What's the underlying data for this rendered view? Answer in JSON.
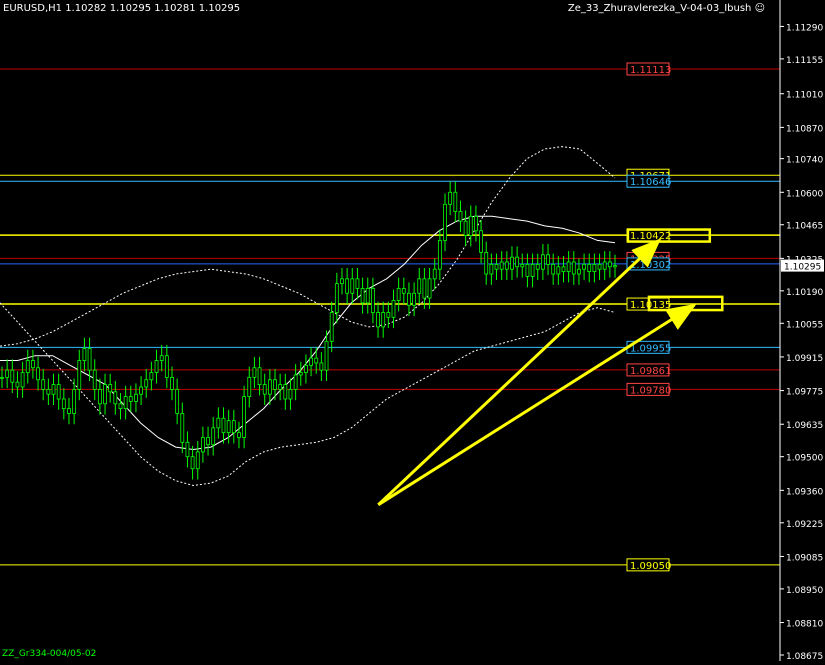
{
  "header": {
    "symbol_info": "EURUSD,H1  1.10282 1.10295 1.10281 1.10295",
    "indicator_name": "Ze_33_Zhuravlerezka_V-04-03_Ibush",
    "smiley_icon": "smiley-icon"
  },
  "footer": {
    "label": "ZZ_Gr334-004/05-02"
  },
  "colors": {
    "background": "#000000",
    "candle": "#00ff00",
    "price_line_red": "#c00000",
    "yellow": "#ffff00",
    "cyan": "#33bbff",
    "orange": "#ff8800",
    "blue": "#2266ff",
    "white": "#ffffff",
    "label_red": "#ff4444"
  },
  "chart_data": {
    "type": "candlestick",
    "symbol": "EURUSD",
    "timeframe": "H1",
    "current_price": "1.10295",
    "ylim": [
      1.0865,
      1.114
    ],
    "y_ticks": [
      "1.11290",
      "1.11155",
      "1.11010",
      "1.10870",
      "1.10740",
      "1.10600",
      "1.10465",
      "1.10325",
      "1.10190",
      "1.10055",
      "1.09915",
      "1.09775",
      "1.09635",
      "1.09500",
      "1.09360",
      "1.09225",
      "1.09085",
      "1.08950",
      "1.08810",
      "1.08675"
    ],
    "levels": [
      {
        "label": "1.11113",
        "value": 1.11113,
        "color": "#c00000",
        "label_color": "#ff4444",
        "style": "solid"
      },
      {
        "label": "1.10671",
        "value": 1.10671,
        "color": "#ffff00",
        "label_color": "#ffff00",
        "style": "solid"
      },
      {
        "label": "1.10646",
        "value": 1.10646,
        "color": "#33bbff",
        "label_color": "#33bbff",
        "style": "solid"
      },
      {
        "label": "1.10422",
        "value": 1.10422,
        "color": "#ffff00",
        "label_color": "#ffff00",
        "style": "solid",
        "highlight": true
      },
      {
        "label": "1.10325",
        "value": 1.10325,
        "color": "#c00000",
        "label_color": "#ff4444",
        "style": "solid"
      },
      {
        "label": "1.10302",
        "value": 1.10302,
        "color": "#2266ff",
        "label_color": "#33bbff",
        "style": "solid"
      },
      {
        "label": "1.10135",
        "value": 1.10135,
        "color": "#ffff00",
        "label_color": "#ffff00",
        "style": "solid",
        "highlight": true
      },
      {
        "label": "1.09955",
        "value": 1.09955,
        "color": "#33bbff",
        "label_color": "#33bbff",
        "style": "solid"
      },
      {
        "label": "1.09861",
        "value": 1.09861,
        "color": "#c00000",
        "label_color": "#ff4444",
        "style": "solid"
      },
      {
        "label": "1.09780",
        "value": 1.0978,
        "color": "#c00000",
        "label_color": "#ff4444",
        "style": "solid"
      },
      {
        "label": "1.09050",
        "value": 1.0905,
        "color": "#ffff00",
        "label_color": "#ffff00",
        "style": "solid"
      }
    ],
    "candles_close": [
      1.0983,
      1.0986,
      1.0981,
      1.0979,
      1.0985,
      1.099,
      1.0987,
      1.0982,
      1.0978,
      1.0976,
      1.098,
      1.0974,
      1.097,
      1.0968,
      1.0978,
      1.099,
      1.0995,
      1.0986,
      1.0978,
      1.0972,
      1.098,
      1.0977,
      1.0972,
      1.097,
      1.0975,
      1.0973,
      1.0976,
      1.0979,
      1.0982,
      1.0985,
      1.099,
      1.0992,
      1.0983,
      1.0978,
      1.0968,
      1.0956,
      1.095,
      1.0945,
      1.0952,
      1.0958,
      1.0955,
      1.0962,
      1.0966,
      1.096,
      1.0965,
      1.096,
      1.0958,
      1.0975,
      1.0983,
      1.0987,
      1.098,
      1.0976,
      1.0982,
      1.0978,
      1.098,
      1.0974,
      1.0978,
      1.0984,
      1.0985,
      1.0988,
      1.0991,
      1.0989,
      1.0986,
      1.0998,
      1.101,
      1.1022,
      1.1024,
      1.1018,
      1.1024,
      1.102,
      1.1014,
      1.102,
      1.101,
      1.1004,
      1.101,
      1.1008,
      1.1015,
      1.102,
      1.1018,
      1.1013,
      1.1018,
      1.1024,
      1.1016,
      1.1024,
      1.1028,
      1.104,
      1.1055,
      1.106,
      1.1052,
      1.1048,
      1.1042,
      1.105,
      1.1044,
      1.1035,
      1.1026,
      1.103,
      1.1028,
      1.1031,
      1.1028,
      1.1033,
      1.1029,
      1.103,
      1.1025,
      1.103,
      1.1028,
      1.1034,
      1.103,
      1.1026,
      1.1029,
      1.1027,
      1.1031,
      1.1026,
      1.1028,
      1.103,
      1.1027,
      1.103,
      1.1028,
      1.1031,
      1.1029,
      1.10295
    ],
    "bands": {
      "upper_dotted": [
        1.0996,
        1.0997,
        1.0999,
        1.1002,
        1.1006,
        1.101,
        1.1014,
        1.1018,
        1.1021,
        1.1024,
        1.1026,
        1.1027,
        1.1028,
        1.1027,
        1.1026,
        1.1024,
        1.1021,
        1.1018,
        1.1014,
        1.101,
        1.1006,
        1.1004,
        1.1005,
        1.1008,
        1.1014,
        1.1022,
        1.1032,
        1.1044,
        1.1056,
        1.1066,
        1.1074,
        1.1078,
        1.1079,
        1.1078,
        1.1072,
        1.1066
      ],
      "lower_dotted": [
        1.1014,
        1.1006,
        1.0998,
        1.099,
        1.0982,
        1.0974,
        1.0966,
        1.0958,
        1.095,
        1.0944,
        1.094,
        1.0938,
        1.0939,
        1.0942,
        1.0948,
        1.0952,
        1.0954,
        1.0955,
        1.0956,
        1.0958,
        1.0962,
        1.0968,
        1.0974,
        1.0978,
        1.0982,
        1.0986,
        1.099,
        1.0994,
        1.0996,
        1.0998,
        1.1,
        1.1002,
        1.1006,
        1.101,
        1.1012,
        1.101
      ],
      "middle_white": [
        1.099,
        1.099,
        1.0992,
        1.0992,
        1.0988,
        1.0984,
        1.098,
        1.0972,
        1.0964,
        1.0958,
        1.0954,
        1.0953,
        1.0954,
        1.0958,
        1.0964,
        1.097,
        1.0978,
        1.0985,
        1.0994,
        1.1005,
        1.1014,
        1.102,
        1.1024,
        1.103,
        1.1038,
        1.1044,
        1.1048,
        1.105,
        1.105,
        1.1049,
        1.1048,
        1.1046,
        1.1045,
        1.1043,
        1.104,
        1.1039
      ]
    },
    "annotations": {
      "arrows": [
        {
          "from": [
            0.485,
            1.093
          ],
          "to": [
            0.845,
            1.104
          ]
        },
        {
          "from": [
            0.485,
            1.093
          ],
          "to": [
            0.89,
            1.1013
          ]
        }
      ],
      "boxes": [
        {
          "x": [
            0.805,
            0.91
          ],
          "y": [
            1.10395,
            1.10445
          ]
        },
        {
          "x": [
            0.832,
            0.926
          ],
          "y": [
            1.1011,
            1.10165
          ]
        }
      ]
    }
  }
}
